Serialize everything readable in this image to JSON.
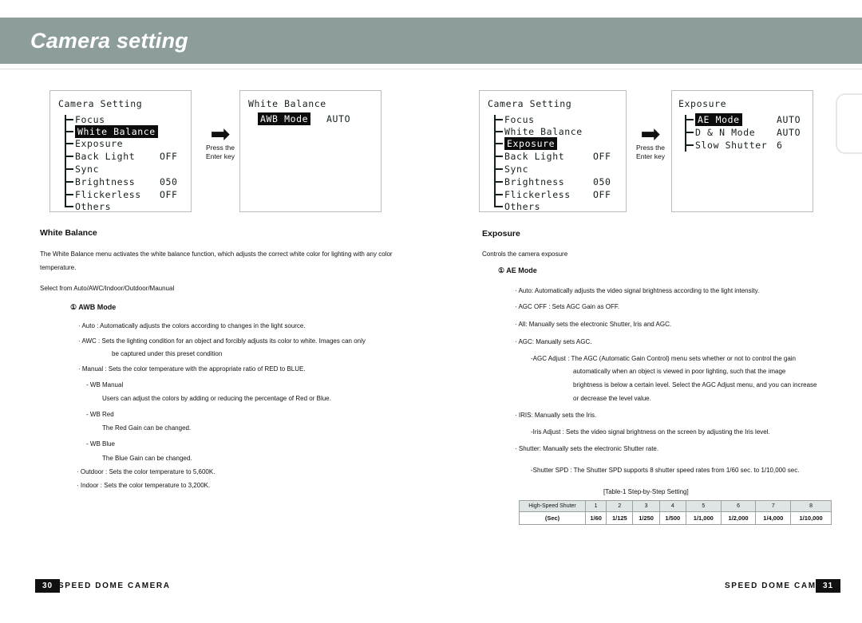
{
  "header": {
    "title": "Camera setting"
  },
  "osd_panels": [
    {
      "name": "camera-setting-white-balance",
      "title": "Camera Setting",
      "rows": [
        {
          "label": "Focus",
          "value": "",
          "highlighted": false
        },
        {
          "label": "White Balance",
          "value": "",
          "highlighted": true
        },
        {
          "label": "Exposure",
          "value": "",
          "highlighted": false
        },
        {
          "label": "Back Light",
          "value": "OFF",
          "highlighted": false
        },
        {
          "label": "Sync",
          "value": "",
          "highlighted": false
        },
        {
          "label": "Brightness",
          "value": "050",
          "highlighted": false
        },
        {
          "label": "Flickerless",
          "value": "OFF",
          "highlighted": false
        },
        {
          "label": "Others",
          "value": "",
          "highlighted": false
        }
      ]
    },
    {
      "name": "white-balance-menu",
      "title": "White Balance",
      "rows": [
        {
          "label": "AWB Mode",
          "value": "AUTO",
          "highlighted": true
        }
      ]
    },
    {
      "name": "camera-setting-exposure",
      "title": "Camera Setting",
      "rows": [
        {
          "label": "Focus",
          "value": "",
          "highlighted": false
        },
        {
          "label": "White Balance",
          "value": "",
          "highlighted": false
        },
        {
          "label": "Exposure",
          "value": "",
          "highlighted": true
        },
        {
          "label": "Back Light",
          "value": "OFF",
          "highlighted": false
        },
        {
          "label": "Sync",
          "value": "",
          "highlighted": false
        },
        {
          "label": "Brightness",
          "value": "050",
          "highlighted": false
        },
        {
          "label": "Flickerless",
          "value": "OFF",
          "highlighted": false
        },
        {
          "label": "Others",
          "value": "",
          "highlighted": false
        }
      ]
    },
    {
      "name": "exposure-menu",
      "title": "Exposure",
      "rows": [
        {
          "label": "AE Mode",
          "value": "AUTO",
          "highlighted": true
        },
        {
          "label": "D & N Mode",
          "value": "AUTO",
          "highlighted": false
        },
        {
          "label": "Slow Shutter",
          "value": "6",
          "highlighted": false
        }
      ]
    }
  ],
  "arrows": {
    "glyph": "➡",
    "caption_line1": "Press the",
    "caption_line2": "Enter key"
  },
  "left_column": {
    "heading": "White Balance",
    "intro_line1": "The White Balance menu activates the white balance function, which adjusts the correct white color for lighting with any color",
    "intro_line2": "temperature.",
    "select_line": "Select from Auto/AWC/Indoor/Outdoor/Maunual",
    "sub_marker": "①",
    "sub_heading": "AWB Mode",
    "bullets": [
      "· Auto : Automatically adjusts the colors according to changes in the light source.",
      "· AWC : Sets the lighting condition for an object and forcibly adjusts its color to white. Images can only",
      "be captured under this preset condition",
      "· Manual : Sets the color temperature with the appropriate ratio of RED to BLUE.",
      "- WB Manual",
      "Users can adjust the colors by adding or reducing the percentage of Red or Blue.",
      "- WB Red",
      "The Red Gain can be changed.",
      "- WB Blue",
      "The Blue Gain can be changed.",
      "· Outdoor : Sets the color temperature to 5,600K.",
      "· Indoor  : Sets the color temperature to 3,200K."
    ]
  },
  "right_column": {
    "heading": "Exposure",
    "intro_line1": "Controls the camera exposure",
    "sub_marker": "①",
    "sub_heading": "AE Mode",
    "bullets": [
      "· Auto: Automatically adjusts the video signal brightness according to the light intensity.",
      "· AGC OFF : Sets AGC Gain as OFF.",
      "· All: Manually sets the electronic Shutter, Iris and AGC.",
      "· AGC: Manually sets AGC.",
      "-AGC Adjust : The AGC (Automatic Gain Control) menu sets whether or not to control the gain",
      "automatically when an object is viewed in poor lighting, such that the image",
      "brightness is below a certain level. Select the AGC Adjust menu, and you can increase",
      "or decrease the level value.",
      "· IRIS: Manually sets the Iris.",
      "-Iris Adjust : Sets the video signal brightness on the screen by adjusting the Iris level.",
      "· Shutter: Manually sets the electronic Shutter rate.",
      "-Shutter SPD : The Shutter SPD supports 8 shutter speed rates from 1/60 sec. to 1/10,000 sec."
    ],
    "table_caption": "[Table-1 Step-by-Step Setting]",
    "table": {
      "row_label_1": "High-Speed Shuter",
      "row_label_2": "(Sec)",
      "steps": [
        "1",
        "2",
        "3",
        "4",
        "5",
        "6",
        "7",
        "8"
      ],
      "seconds": [
        "1/60",
        "1/125",
        "1/250",
        "1/500",
        "1/1,000",
        "1/2,000",
        "1/4,000",
        "1/10,000"
      ]
    }
  },
  "footer": {
    "left_page": "30",
    "left_text": "SPEED DOME CAMERA",
    "right_text": "SPEED DOME CAMERA",
    "right_page": "31"
  }
}
